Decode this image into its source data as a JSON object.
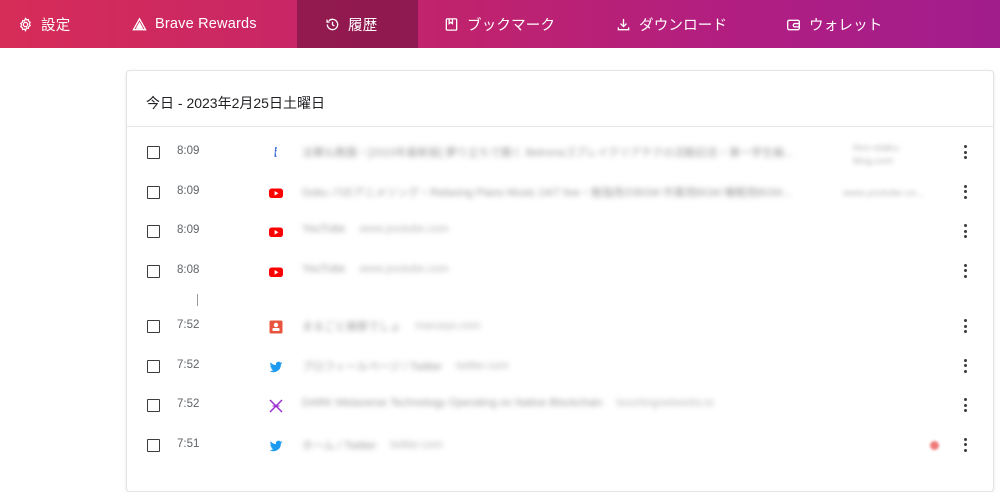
{
  "nav": {
    "settings": "設定",
    "rewards": "Brave Rewards",
    "history": "履歴",
    "bookmarks": "ブックマーク",
    "downloads": "ダウンロード",
    "wallet": "ウォレット"
  },
  "history": {
    "date_header": "今日 - 2023年2月25日土曜日",
    "entries": [
      {
        "time": "8:09",
        "title": "法華仏教園・[2023年最新版] 夢り立ちで聞く Betronaゴブレイクリアテクの活動記念・第一学生編...",
        "domain": "hiro-otaku-blog.com",
        "favicon": "blog-icon"
      },
      {
        "time": "8:09",
        "title": "Goku パのアニメソング・Relaxing Piano Music 24/7 live・勉強用のBGM 作業用BGM 睡眠用BGM...",
        "domain": "www.youtube.co...",
        "favicon": "youtube-icon"
      },
      {
        "time": "8:09",
        "title": "YouTube",
        "domain": "www.youtube.com",
        "favicon": "youtube-icon"
      },
      {
        "time": "8:08",
        "title": "YouTube",
        "domain": "www.youtube.com",
        "favicon": "youtube-icon"
      },
      {
        "time": "7:52",
        "title": "まるごと検索でしょ",
        "domain": "marusys.com",
        "favicon": "cooking-icon"
      },
      {
        "time": "7:52",
        "title": "プロフィールページ / Twitter",
        "domain": "twitter.com",
        "favicon": "twitter-icon"
      },
      {
        "time": "7:52",
        "title": "DARK Metaverse Technology Operating on Native Blockchain",
        "domain": "touchingnetworks.io",
        "favicon": "metaverse-icon"
      },
      {
        "time": "7:51",
        "title": "ホーム / Twitter",
        "domain": "twitter.com",
        "favicon": "twitter-icon"
      }
    ]
  },
  "colors": {
    "nav_start": "#d62c58",
    "nav_end": "#a11d8c",
    "youtube": "#ff0000",
    "twitter": "#1d9bf0",
    "metaverse": "#9b2fd0"
  }
}
